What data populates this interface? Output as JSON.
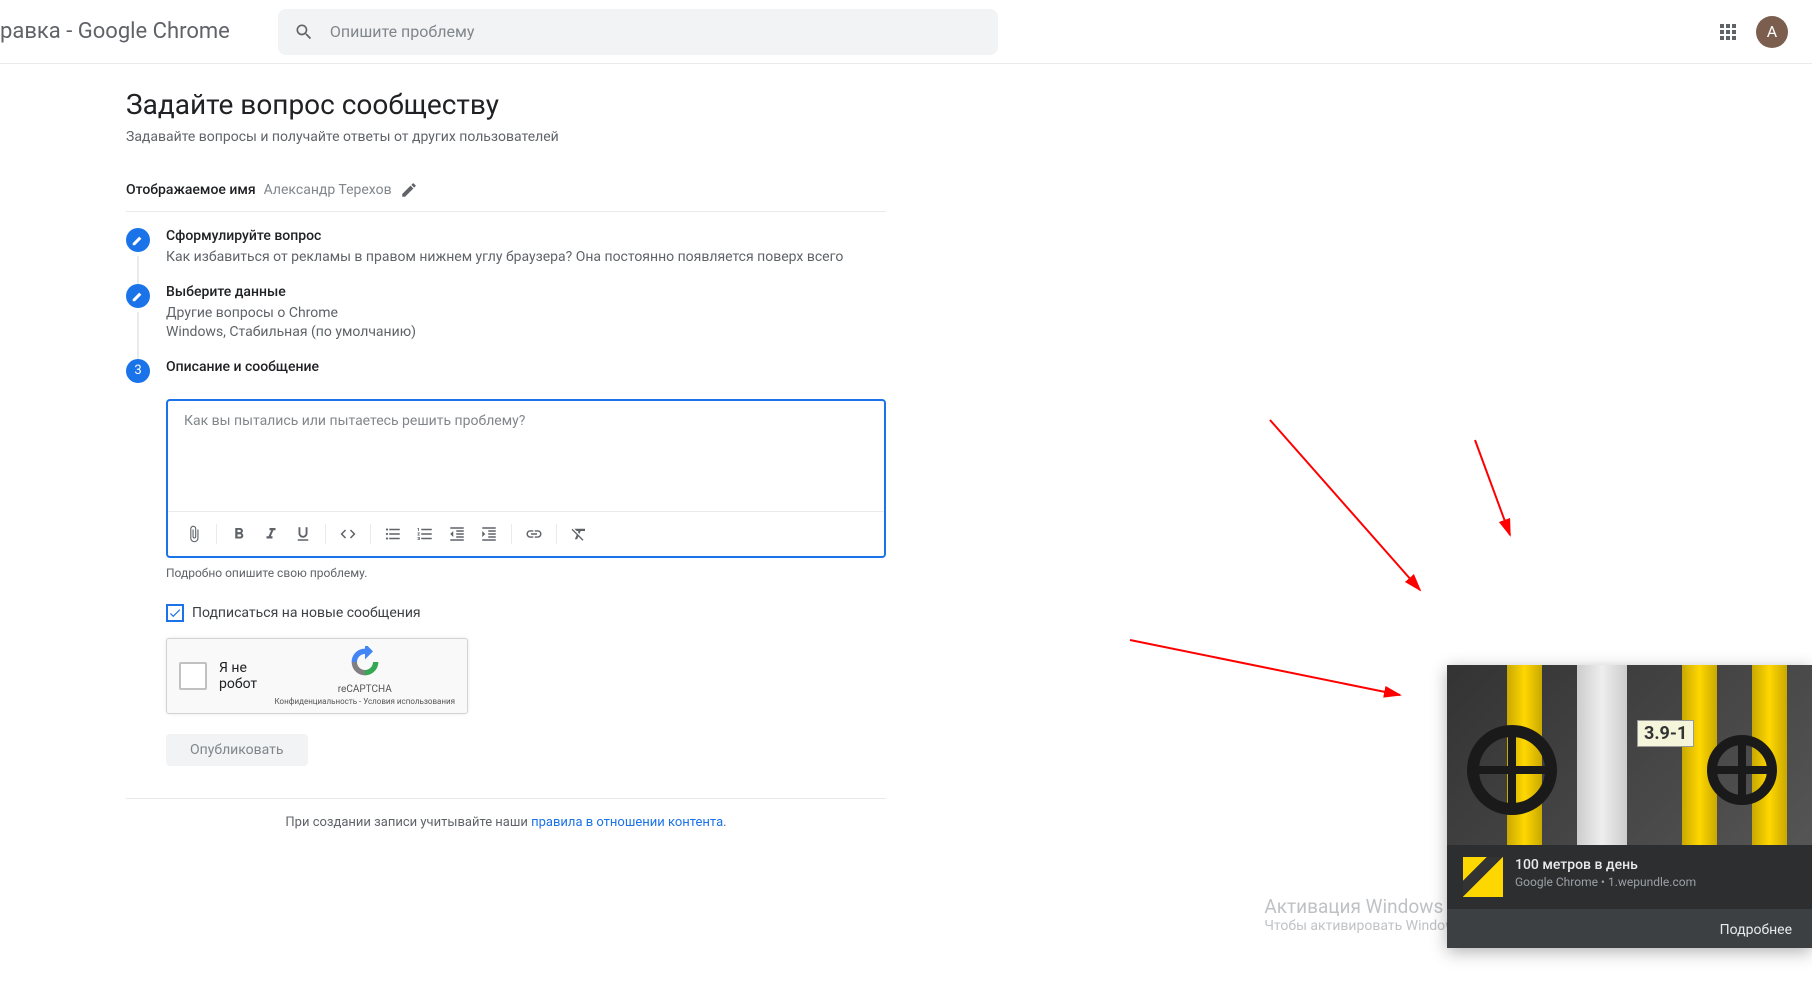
{
  "header": {
    "title": "равка - Google Chrome",
    "search_placeholder": "Опишите проблему",
    "avatar_initial": "А"
  },
  "page": {
    "title": "Задайте вопрос сообществу",
    "subtitle": "Задавайте вопросы и получайте ответы от других пользователей"
  },
  "display_name": {
    "label": "Отображаемое имя",
    "value": "Александр Терехов"
  },
  "steps": [
    {
      "title": "Сформулируйте вопрос",
      "desc": "Как избавиться от рекламы в правом нижнем углу браузера? Она постоянно появляется поверх всего",
      "done": true
    },
    {
      "title": "Выберите данные",
      "desc": "Другие вопросы о Chrome\nWindows, Стабильная (по умолчанию)",
      "done": true
    },
    {
      "title": "Описание и сообщение",
      "number": "3",
      "done": false
    }
  ],
  "editor": {
    "placeholder": "Как вы пытались или пытаетесь решить проблему?",
    "hint": "Подробно опишите свою проблему."
  },
  "subscribe": {
    "label": "Подписаться на новые сообщения",
    "checked": true
  },
  "recaptcha": {
    "label": "Я не робот",
    "brand": "reCAPTCHA",
    "terms": "Конфиденциальность - Условия использования"
  },
  "publish": {
    "label": "Опубликовать"
  },
  "footer": {
    "prefix": "При создании записи учитывайте наши ",
    "link": "правила в отношении контента",
    "suffix": "."
  },
  "notification": {
    "title": "100 метров в день",
    "source": "Google Chrome • 1.wepundle.com",
    "action": "Подробнее",
    "image_label": "3.9-1"
  },
  "watermark": {
    "title": "Активация Windows",
    "desc": "Чтобы активировать Windows, перейдите в раздел \"Параметры\"."
  }
}
